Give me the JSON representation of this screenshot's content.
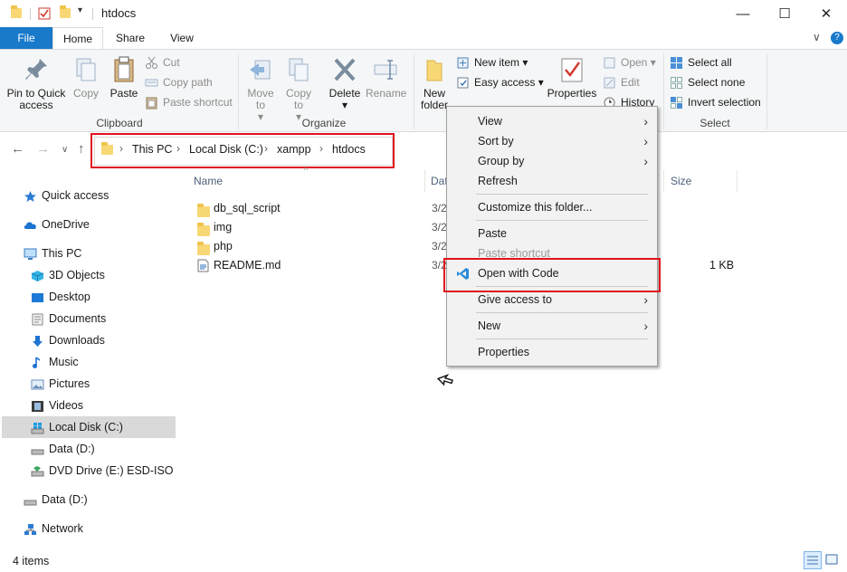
{
  "window": {
    "title": "htdocs",
    "minimize": "—",
    "maximize": "☐",
    "close": "✕"
  },
  "tabs": {
    "file": "File",
    "home": "Home",
    "share": "Share",
    "view": "View",
    "collapse": "∨",
    "help": "?"
  },
  "ribbon": {
    "clipboard": {
      "label": "Clipboard",
      "pin": "Pin to Quick access",
      "copy": "Copy",
      "paste": "Paste",
      "cut": "Cut",
      "copy_path": "Copy path",
      "paste_shortcut": "Paste shortcut"
    },
    "organize": {
      "label": "Organize",
      "move_to": "Move to",
      "copy_to": "Copy to",
      "delete": "Delete",
      "rename": "Rename"
    },
    "new": {
      "new_folder_l1": "New",
      "new_folder_l2": "folder",
      "new_item": "New item",
      "easy_access": "Easy access"
    },
    "open": {
      "properties": "Properties",
      "open": "Open",
      "edit": "Edit",
      "history": "History"
    },
    "select": {
      "label": "Select",
      "select_all": "Select all",
      "select_none": "Select none",
      "invert": "Invert selection"
    }
  },
  "address": {
    "crumbs": [
      "This PC",
      "Local Disk (C:)",
      "xampp",
      "htdocs"
    ]
  },
  "navpane": {
    "items": [
      "Quick access",
      "OneDrive",
      "This PC",
      "3D Objects",
      "Desktop",
      "Documents",
      "Downloads",
      "Music",
      "Pictures",
      "Videos",
      "Local Disk (C:)",
      "Data (D:)",
      "DVD Drive (E:) ESD-ISO",
      "Data (D:)",
      "Network"
    ]
  },
  "columns": {
    "name": "Name",
    "date": "Dat",
    "size": "Size"
  },
  "files": [
    {
      "name": "db_sql_script",
      "date": "3/2",
      "size": ""
    },
    {
      "name": "img",
      "date": "3/2",
      "size": ""
    },
    {
      "name": "php",
      "date": "3/2",
      "size": ""
    },
    {
      "name": "README.md",
      "date": "3/2",
      "size": "1 KB"
    }
  ],
  "context_menu": {
    "view": "View",
    "sort_by": "Sort by",
    "group_by": "Group by",
    "refresh": "Refresh",
    "customize": "Customize this folder...",
    "paste": "Paste",
    "paste_shortcut": "Paste shortcut",
    "open_with_code": "Open with Code",
    "give_access": "Give access to",
    "new": "New",
    "properties": "Properties"
  },
  "status": {
    "count": "4 items"
  },
  "colors": {
    "file_tab": "#1979ca",
    "highlight_box": "#e0121f",
    "folder": "#f8d775",
    "vscode": "#2a8ad8"
  }
}
